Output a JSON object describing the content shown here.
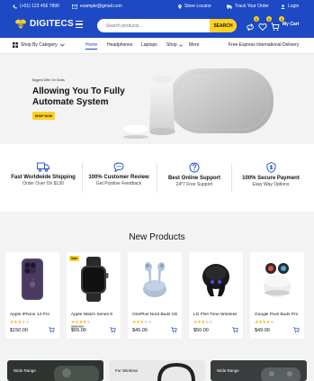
{
  "topbar": {
    "phone": "(+01) 123 456 7890",
    "email": "example@gmail.com",
    "store_locator": "Store Locator",
    "track_order": "Track Your Order",
    "login": "Login"
  },
  "header": {
    "logo": "DIGITECS",
    "search_placeholder": "Search products...",
    "search_button": "SEARCH",
    "compare_count": "0",
    "wishlist_count": "0",
    "cart_count": "0",
    "cart_label": "My Cart"
  },
  "nav": {
    "category_label": "Shop By Category",
    "links": [
      "Home",
      "Headphones",
      "Laptops",
      "Shop",
      "More"
    ],
    "promo": "Free Express International Delivery"
  },
  "hero": {
    "kicker": "Biggest Offer On Deals",
    "title": "Allowing You To Fully Automate System",
    "button": "SHOP NOW"
  },
  "features": [
    {
      "title": "Fast Worldwide Shipping",
      "sub": "Order Over On $130",
      "icon": "truck-icon"
    },
    {
      "title": "100% Customer Review",
      "sub": "Get Positive Feedback",
      "icon": "chat-icon"
    },
    {
      "title": "Best Online Support",
      "sub": "24*7 Free Support",
      "icon": "question-icon"
    },
    {
      "title": "100% Secure Payment",
      "sub": "Easy Way Options",
      "icon": "shield-icon"
    }
  ],
  "new_products": {
    "title": "New Products",
    "items": [
      {
        "name": "Apple iPhone 14 Pro",
        "rating": 3,
        "old_price": "",
        "price": "$150.00",
        "badge": ""
      },
      {
        "name": "Apple Watch Series 8",
        "rating": 4,
        "old_price": "$80.00",
        "price": "$65.00",
        "badge": "Sale"
      },
      {
        "name": "OnePlus Nord Buds CE",
        "rating": 3,
        "old_price": "",
        "price": "$45.00",
        "badge": ""
      },
      {
        "name": "LG FNA Tone Wireless",
        "rating": 3,
        "old_price": "",
        "price": "$50.00",
        "badge": ""
      },
      {
        "name": "Google Pixel Buds Pro",
        "rating": 4,
        "old_price": "",
        "price": "$49.00",
        "badge": ""
      }
    ]
  },
  "banners": [
    "Wide Range",
    "For Wireless",
    "Wide Range"
  ],
  "colors": {
    "brand": "#1d49c4",
    "accent": "#ffd21f",
    "star": "#f5b014"
  }
}
